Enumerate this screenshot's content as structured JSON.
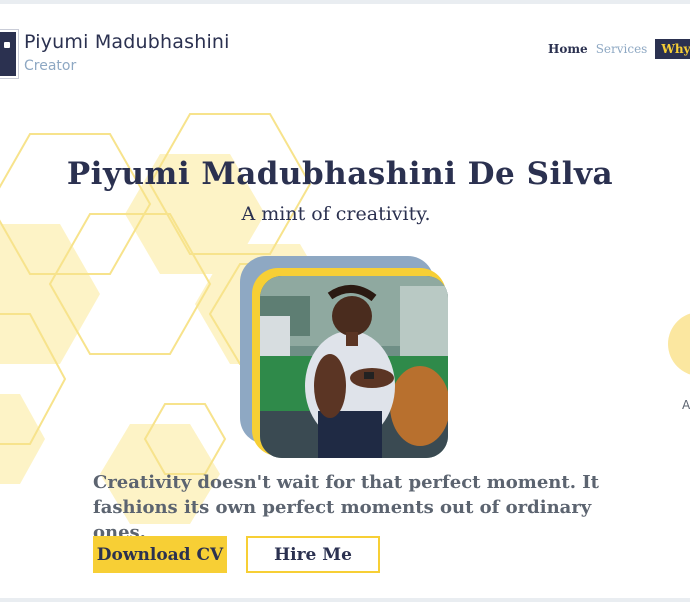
{
  "header": {
    "site_name": "Piyumi Madubhashini",
    "site_tagline": "Creator",
    "nav": {
      "home": "Home",
      "services": "Services",
      "why": "Why I"
    }
  },
  "hero": {
    "title": "Piyumi Madubhashini De Silva",
    "subtitle": "A mint of creativity.",
    "quote": "Creativity doesn't wait for that perfect moment. It fashions its own perfect moments out of ordinary ones.",
    "download_cv": "Download CV",
    "hire_me": "Hire Me"
  },
  "side_control": {
    "label": "A"
  },
  "colors": {
    "navy": "#2b3150",
    "accent_yellow": "#f7cf35",
    "muted_blue": "#8ea8c3",
    "text_gray": "#5c6470"
  },
  "icons": {
    "logo": "logo-mark-icon",
    "profile": "profile-photo"
  }
}
